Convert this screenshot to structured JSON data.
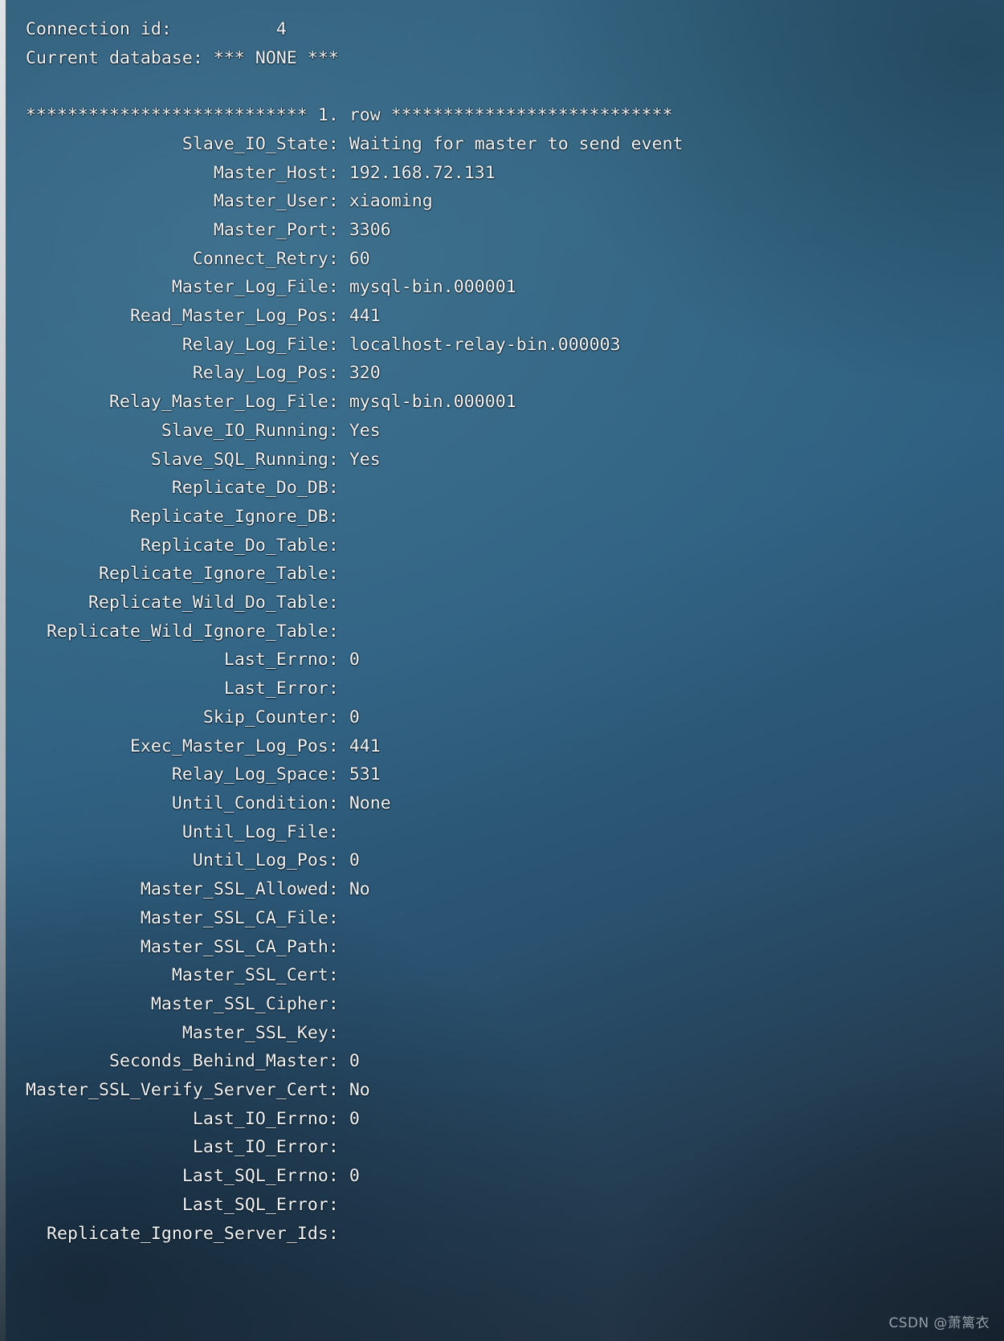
{
  "terminal": {
    "app": "mysql-client",
    "background_color": "#2f6081",
    "text_color": "#f2f5f7",
    "header_lines": [
      "Connection id:          4",
      "Current database: *** NONE ***"
    ],
    "blank_line": "",
    "row_separator": "*************************** 1. row ***************************",
    "fields": [
      {
        "label": "Slave_IO_State",
        "value": "Waiting for master to send event"
      },
      {
        "label": "Master_Host",
        "value": "192.168.72.131"
      },
      {
        "label": "Master_User",
        "value": "xiaoming"
      },
      {
        "label": "Master_Port",
        "value": "3306"
      },
      {
        "label": "Connect_Retry",
        "value": "60"
      },
      {
        "label": "Master_Log_File",
        "value": "mysql-bin.000001"
      },
      {
        "label": "Read_Master_Log_Pos",
        "value": "441"
      },
      {
        "label": "Relay_Log_File",
        "value": "localhost-relay-bin.000003"
      },
      {
        "label": "Relay_Log_Pos",
        "value": "320"
      },
      {
        "label": "Relay_Master_Log_File",
        "value": "mysql-bin.000001"
      },
      {
        "label": "Slave_IO_Running",
        "value": "Yes"
      },
      {
        "label": "Slave_SQL_Running",
        "value": "Yes"
      },
      {
        "label": "Replicate_Do_DB",
        "value": ""
      },
      {
        "label": "Replicate_Ignore_DB",
        "value": ""
      },
      {
        "label": "Replicate_Do_Table",
        "value": ""
      },
      {
        "label": "Replicate_Ignore_Table",
        "value": ""
      },
      {
        "label": "Replicate_Wild_Do_Table",
        "value": ""
      },
      {
        "label": "Replicate_Wild_Ignore_Table",
        "value": ""
      },
      {
        "label": "Last_Errno",
        "value": "0"
      },
      {
        "label": "Last_Error",
        "value": ""
      },
      {
        "label": "Skip_Counter",
        "value": "0"
      },
      {
        "label": "Exec_Master_Log_Pos",
        "value": "441"
      },
      {
        "label": "Relay_Log_Space",
        "value": "531"
      },
      {
        "label": "Until_Condition",
        "value": "None"
      },
      {
        "label": "Until_Log_File",
        "value": ""
      },
      {
        "label": "Until_Log_Pos",
        "value": "0"
      },
      {
        "label": "Master_SSL_Allowed",
        "value": "No"
      },
      {
        "label": "Master_SSL_CA_File",
        "value": ""
      },
      {
        "label": "Master_SSL_CA_Path",
        "value": ""
      },
      {
        "label": "Master_SSL_Cert",
        "value": ""
      },
      {
        "label": "Master_SSL_Cipher",
        "value": ""
      },
      {
        "label": "Master_SSL_Key",
        "value": ""
      },
      {
        "label": "Seconds_Behind_Master",
        "value": "0"
      },
      {
        "label": "Master_SSL_Verify_Server_Cert",
        "value": "No"
      },
      {
        "label": "Last_IO_Errno",
        "value": "0"
      },
      {
        "label": "Last_IO_Error",
        "value": ""
      },
      {
        "label": "Last_SQL_Errno",
        "value": "0"
      },
      {
        "label": "Last_SQL_Error",
        "value": ""
      },
      {
        "label": "Replicate_Ignore_Server_Ids",
        "value": ""
      }
    ],
    "label_column_width": 29
  },
  "watermark": {
    "text": "CSDN @萧篱衣"
  }
}
